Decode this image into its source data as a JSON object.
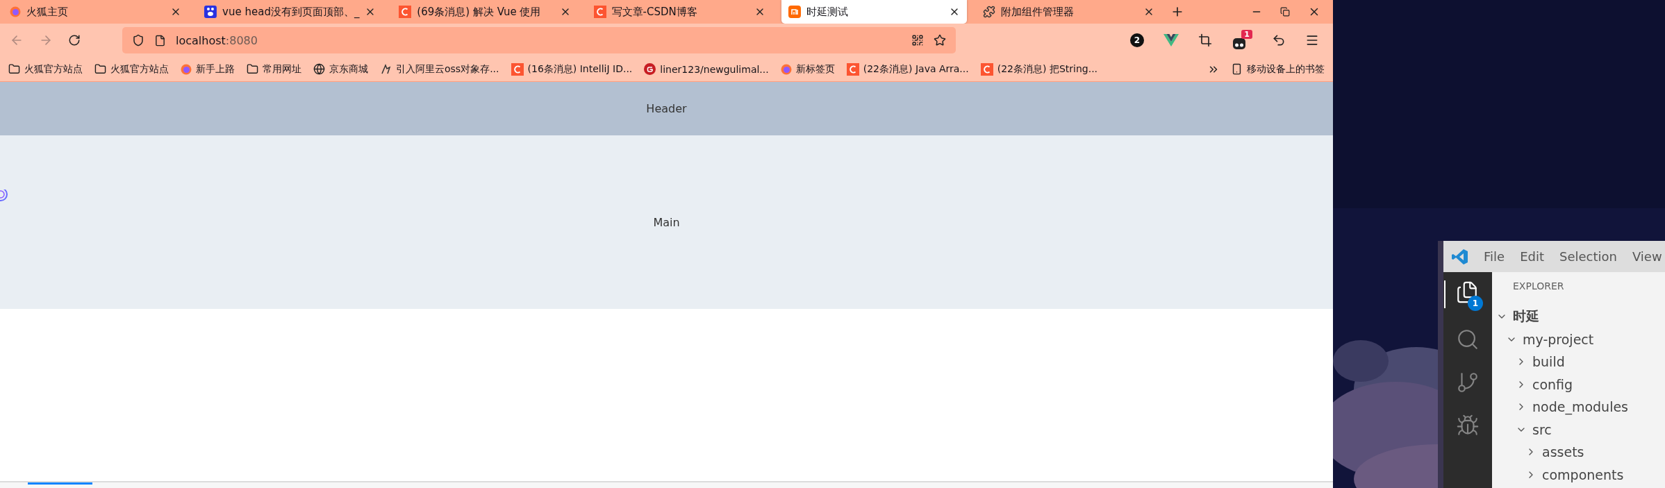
{
  "browser": {
    "tabs": [
      {
        "title": "火狐主页",
        "kind": "firefox",
        "selected": false
      },
      {
        "title": "vue head没有到页面顶部、_",
        "kind": "paw",
        "selected": false
      },
      {
        "title": "(69条消息) 解决 Vue 使用",
        "kind": "csdn",
        "selected": false
      },
      {
        "title": "写文章-CSDN博客",
        "kind": "csdn",
        "selected": false
      },
      {
        "title": "时延测试",
        "kind": "mi",
        "selected": true
      },
      {
        "title": "附加组件管理器",
        "kind": "puzzle",
        "selected": false
      }
    ],
    "address": {
      "host": "localhost",
      "port": ":8080"
    },
    "toolbar": {
      "count": "2",
      "extension_badge": "1"
    },
    "bookmarks": [
      {
        "label": "火狐官方站点",
        "kind": "folder"
      },
      {
        "label": "火狐官方站点",
        "kind": "folder"
      },
      {
        "label": "新手上路",
        "kind": "firefox"
      },
      {
        "label": "常用网址",
        "kind": "folder"
      },
      {
        "label": "京东商城",
        "kind": "globe"
      },
      {
        "label": "引入阿里云oss对象存...",
        "kind": "sketch"
      },
      {
        "label": "(16条消息) IntelliJ ID...",
        "kind": "csdn"
      },
      {
        "label": "liner123/newgulimal...",
        "kind": "gitee"
      },
      {
        "label": "新标签页",
        "kind": "firefox"
      },
      {
        "label": "(22条消息) Java Arra...",
        "kind": "csdn"
      },
      {
        "label": "(22条消息) 把String...",
        "kind": "csdn"
      }
    ],
    "mobile_bookmarks": "移动设备上的书签"
  },
  "page": {
    "header": "Header",
    "main": "Main"
  },
  "vscode": {
    "menu": [
      "File",
      "Edit",
      "Selection",
      "View"
    ],
    "explorer_badge": "1",
    "sidebar_title": "EXPLORER",
    "tree": [
      {
        "label": "时延",
        "expanded": true,
        "children": [
          {
            "label": "my-project",
            "expanded": true,
            "children": [
              {
                "label": "build",
                "expanded": false
              },
              {
                "label": "config",
                "expanded": false
              },
              {
                "label": "node_modules",
                "expanded": false
              },
              {
                "label": "src",
                "expanded": true,
                "children": [
                  {
                    "label": "assets",
                    "expanded": false
                  },
                  {
                    "label": "components",
                    "expanded": false
                  }
                ]
              }
            ]
          }
        ]
      }
    ]
  }
}
